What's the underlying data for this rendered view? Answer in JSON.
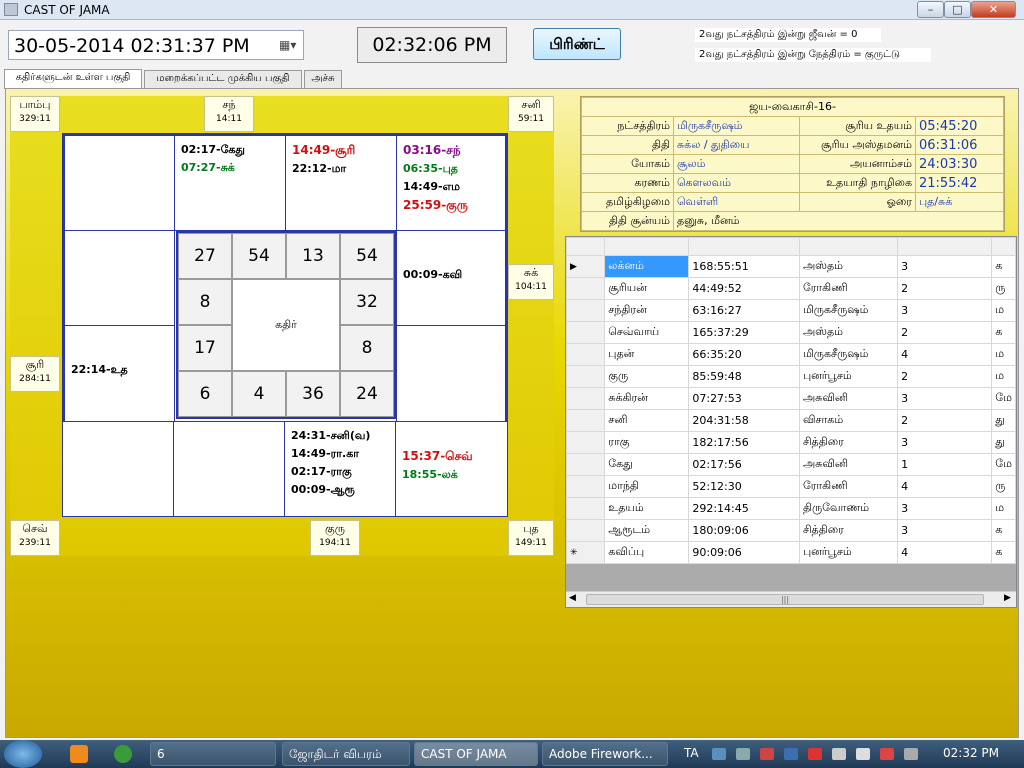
{
  "window": {
    "title": "CAST OF JAMA",
    "min": "–",
    "max": "□",
    "close": "✕"
  },
  "datetime": {
    "value": "30-05-2014 02:31:37 PM"
  },
  "clock": "02:32:06 PM",
  "print_label": "பிரிண்ட்",
  "info_lines": [
    "2வது நட்சத்திரம் இன்று ஜீவன் = 0",
    "2வது நட்சத்திரம் இன்று நேத்திரம் = குருட்டு"
  ],
  "tabs": [
    "கதிர்களுடன் உள்ள பகுதி",
    "மறைக்கப்பட்ட முக்கிய பகுதி",
    "அச்சு"
  ],
  "outer_labels": {
    "tl": {
      "name": "பாம்பு",
      "deg": "329:11"
    },
    "tc": {
      "name": "சந்",
      "deg": "14:11"
    },
    "tr": {
      "name": "சனி",
      "deg": "59:11"
    },
    "ml": {
      "name": "சூரி",
      "deg": "284:11"
    },
    "mr": {
      "name": "சுக்",
      "deg": "104:11"
    },
    "bl": {
      "name": "செவ்",
      "deg": "239:11"
    },
    "bc": {
      "name": "குரு",
      "deg": "194:11"
    },
    "br": {
      "name": "புத",
      "deg": "149:11"
    }
  },
  "chart": {
    "r0c1": [
      {
        "t": "02:17-கேது",
        "c": "black"
      },
      {
        "t": "07:27-சுக்",
        "c": "green"
      }
    ],
    "r0c2": [
      {
        "t": "14:49-சூரி",
        "c": "red"
      },
      {
        "t": "22:12-மா",
        "c": "black"
      }
    ],
    "r0c3": [
      {
        "t": "03:16-சந்",
        "c": "purple"
      },
      {
        "t": "06:35-புத",
        "c": "green"
      },
      {
        "t": "14:49-எம",
        "c": "black"
      },
      {
        "t": "25:59-குரு",
        "c": "red"
      }
    ],
    "r1c3": [
      {
        "t": "00:09-கவி",
        "c": "black"
      }
    ],
    "r2c0": [
      {
        "t": "22:14-உத",
        "c": "black"
      }
    ],
    "r3c2": [
      {
        "t": "24:31-சனி(வ)",
        "c": "black"
      },
      {
        "t": "14:49-ரா.கா",
        "c": "black"
      },
      {
        "t": "02:17-ராகு",
        "c": "black"
      },
      {
        "t": "00:09-ஆரூ",
        "c": "black"
      }
    ],
    "r3c3": [
      {
        "t": "15:37-செவ்",
        "c": "red"
      },
      {
        "t": "18:55-லக்",
        "c": "green"
      }
    ],
    "center_label": "கதிர்",
    "numbers": {
      "top": [
        "27",
        "54",
        "13",
        "54"
      ],
      "left": [
        "8",
        "17"
      ],
      "right": [
        "32",
        "8"
      ],
      "bottom": [
        "6",
        "4",
        "36",
        "24"
      ]
    }
  },
  "details": {
    "title": "ஜய-வைகாசி-16-",
    "rows": [
      [
        "நட்சத்திரம்",
        "மிருகசீருஷம்",
        "சூரிய உதயம்",
        "05:45:20"
      ],
      [
        "திதி",
        "சுக்ல / துதியை",
        "சூரிய அஸ்தமனம்",
        "06:31:06"
      ],
      [
        "யோகம்",
        "சூலம்",
        "அயனாம்சம்",
        "24:03:30"
      ],
      [
        "கரணம்",
        "கௌலவம்",
        "உதயாதி நாழிகை",
        "21:55:42"
      ],
      [
        "தமிழ்கிழமை",
        "வெள்ளி",
        "ஓரை",
        "புத/சுக்"
      ]
    ],
    "thithi_label": "திதி சூன்யம்",
    "thithi_value": "தனுசு, மீனம்"
  },
  "grid": {
    "rows": [
      [
        "லக்னம்",
        "168:55:51",
        "அஸ்தம்",
        "3",
        "க"
      ],
      [
        "சூரியன்",
        "44:49:52",
        "ரோகிணி",
        "2",
        "ரு"
      ],
      [
        "சந்திரன்",
        "63:16:27",
        "மிருகசீருஷம்",
        "3",
        "ம"
      ],
      [
        "செவ்வாய்",
        "165:37:29",
        "அஸ்தம்",
        "2",
        "க"
      ],
      [
        "புதன்",
        "66:35:20",
        "மிருகசீருஷம்",
        "4",
        "ம"
      ],
      [
        "குரு",
        "85:59:48",
        "புனர்பூசம்",
        "2",
        "ம"
      ],
      [
        "சுக்கிரன்",
        "07:27:53",
        "அசுவினி",
        "3",
        "மே"
      ],
      [
        "சனி",
        "204:31:58",
        "விசாகம்",
        "2",
        "து"
      ],
      [
        "ராகு",
        "182:17:56",
        "சித்திரை",
        "3",
        "து"
      ],
      [
        "கேது",
        "02:17:56",
        "அசுவினி",
        "1",
        "மே"
      ],
      [
        "மாந்தி",
        "52:12:30",
        "ரோகிணி",
        "4",
        "ரு"
      ],
      [
        "உதயம்",
        "292:14:45",
        "திருவோணம்",
        "3",
        "ம"
      ],
      [
        "ஆரூடம்",
        "180:09:06",
        "சித்திரை",
        "3",
        "க"
      ],
      [
        "கவிப்பு",
        "90:09:06",
        "புனர்பூசம்",
        "4",
        "க"
      ]
    ],
    "row_markers": [
      "▶",
      "",
      "",
      "",
      "",
      "",
      "",
      "",
      "",
      "",
      "",
      "",
      "",
      "✳"
    ],
    "scroll_thumb": "|||"
  },
  "taskbar": {
    "items": [
      "6",
      "ஜோதிடர் விபரம்",
      "CAST OF JAMA",
      "Adobe Firework..."
    ],
    "lang": "TA",
    "time": "02:32 PM"
  }
}
